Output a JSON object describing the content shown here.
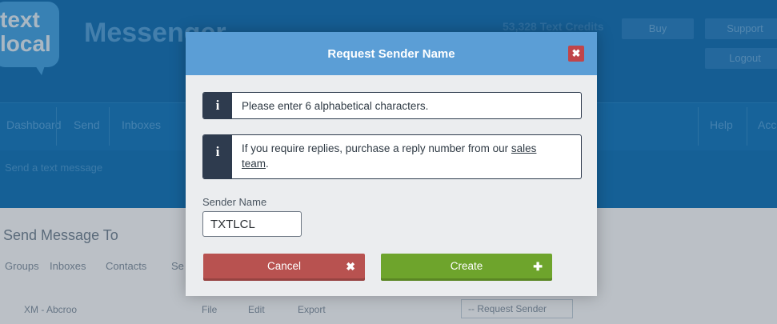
{
  "background": {
    "logo_text": "text\nlocal",
    "app_title": "Messenger",
    "credits": "53,328 Text Credits",
    "buy_label": "Buy",
    "support_label": "Support",
    "logout_label": "Logout",
    "nav": [
      "Dashboard",
      "Send",
      "Inboxes",
      "Help",
      "Acc"
    ],
    "breadcrumb": "Send a text message",
    "send_title": "Send Message To",
    "subtabs": [
      "Groups",
      "Inboxes",
      "Contacts",
      "Se"
    ],
    "row_label": "XM - Abcroo",
    "row_actions": [
      "File",
      "Edit",
      "Export"
    ],
    "request_sender_placeholder": "-- Request Sender"
  },
  "modal": {
    "title": "Request Sender Name",
    "close_icon": "close-icon",
    "info1": {
      "icon": "i",
      "text": "Please enter 6 alphabetical characters."
    },
    "info2": {
      "icon": "i",
      "text_before": "If you require replies, purchase a reply number from our ",
      "link": "sales team",
      "text_after": "."
    },
    "sender_label": "Sender Name",
    "sender_value": "TXTLCL",
    "cancel_label": "Cancel",
    "cancel_icon": "✖",
    "create_label": "Create",
    "create_icon": "✚"
  },
  "colors": {
    "header": "#5b9ed6",
    "close": "#c0454a",
    "info_dark": "#2e3b4e",
    "cancel": "#b85250",
    "create": "#6ea42c"
  }
}
